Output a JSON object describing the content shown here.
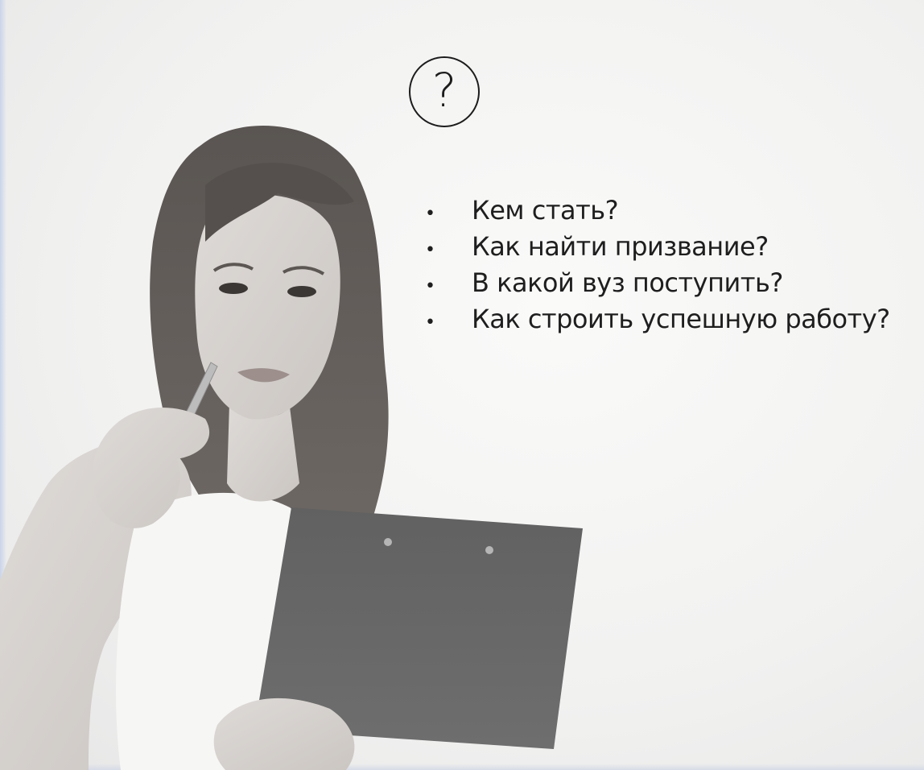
{
  "slide": {
    "question_symbol": "?",
    "bullets": [
      {
        "text": "Кем стать?"
      },
      {
        "text": "Как найти призвание?"
      },
      {
        "text": "В какой вуз поступить?"
      },
      {
        "text": "Как строить успешную работу?"
      }
    ],
    "bullet_glyph": "•"
  },
  "colors": {
    "background": "#f3f3f2",
    "text": "#1e1e1e",
    "edge_tint": "#c9d4ea"
  },
  "icons": [
    "question-circle-icon"
  ]
}
